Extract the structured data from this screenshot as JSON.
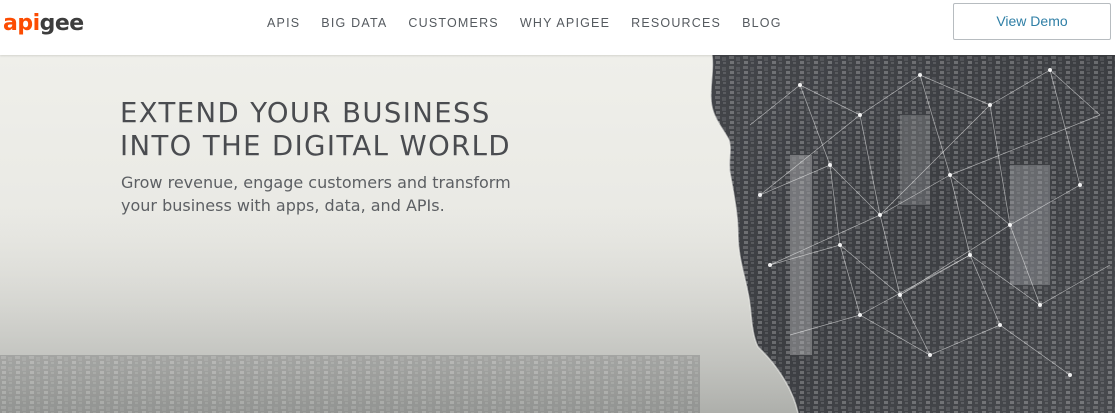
{
  "header": {
    "logo": {
      "accent": "api",
      "rest": "gee"
    },
    "nav": [
      {
        "label": "APIS"
      },
      {
        "label": "BIG DATA"
      },
      {
        "label": "CUSTOMERS"
      },
      {
        "label": "WHY APIGEE"
      },
      {
        "label": "RESOURCES"
      },
      {
        "label": "BLOG"
      }
    ],
    "cta_label": "View Demo"
  },
  "hero": {
    "headline_lines": [
      "EXTEND YOUR BUSINESS",
      "INTO THE DIGITAL WORLD"
    ],
    "subhead_lines": [
      "Grow revenue, engage customers and transform",
      "your business with apps, data, and APIs."
    ]
  },
  "colors": {
    "brand_orange": "#fc4c02",
    "logo_gray": "#3d3d3d",
    "nav_text": "#555a5f",
    "cta_text": "#2f7fa6",
    "headline": "#4a4c50"
  }
}
